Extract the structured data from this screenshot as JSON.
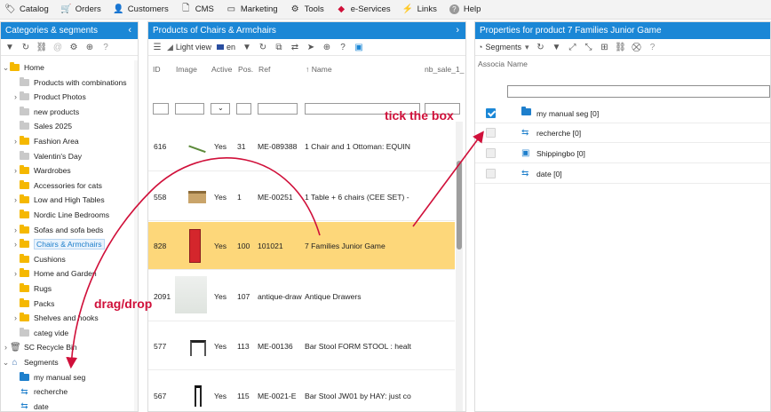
{
  "menu": [
    {
      "label": "Catalog",
      "icon": "catalog-icon",
      "glyph": "🏷"
    },
    {
      "label": "Orders",
      "icon": "cart-icon",
      "glyph": "🛒"
    },
    {
      "label": "Customers",
      "icon": "user-icon",
      "glyph": "👤"
    },
    {
      "label": "CMS",
      "icon": "cms-icon",
      "glyph": "🗋"
    },
    {
      "label": "Marketing",
      "icon": "marketing-icon",
      "glyph": "▭"
    },
    {
      "label": "Tools",
      "icon": "gear-icon",
      "glyph": "⚙"
    },
    {
      "label": "e-Services",
      "icon": "diamond-icon",
      "glyph": "◆"
    },
    {
      "label": "Links",
      "icon": "bolt-icon",
      "glyph": "⚡"
    },
    {
      "label": "Help",
      "icon": "help-icon",
      "glyph": "?"
    }
  ],
  "left_panel": {
    "title": "Categories & segments",
    "tree": [
      {
        "label": "Home",
        "icon": "folder-yellow",
        "caret": "open",
        "indent": 0
      },
      {
        "label": "Products with combinations",
        "icon": "folder-gray",
        "caret": "",
        "indent": 1
      },
      {
        "label": "Product Photos",
        "icon": "folder-gray",
        "caret": "closed",
        "indent": 1
      },
      {
        "label": "new products",
        "icon": "folder-gray",
        "caret": "",
        "indent": 1
      },
      {
        "label": "Sales 2025",
        "icon": "folder-gray",
        "caret": "",
        "indent": 1
      },
      {
        "label": "Fashion Area",
        "icon": "folder-yellow",
        "caret": "closed",
        "indent": 1
      },
      {
        "label": "Valentin's Day",
        "icon": "folder-gray",
        "caret": "",
        "indent": 1
      },
      {
        "label": "Wardrobes",
        "icon": "folder-yellow",
        "caret": "closed",
        "indent": 1
      },
      {
        "label": "Accessories for cats",
        "icon": "folder-yellow",
        "caret": "",
        "indent": 1
      },
      {
        "label": "Low and High Tables",
        "icon": "folder-yellow",
        "caret": "closed",
        "indent": 1
      },
      {
        "label": "Nordic Line Bedrooms",
        "icon": "folder-yellow",
        "caret": "",
        "indent": 1
      },
      {
        "label": "Sofas and sofa beds",
        "icon": "folder-yellow",
        "caret": "closed",
        "indent": 1
      },
      {
        "label": "Chairs & Armchairs",
        "icon": "folder-yellow",
        "caret": "closed",
        "indent": 1,
        "selected": true
      },
      {
        "label": "Cushions",
        "icon": "folder-yellow",
        "caret": "",
        "indent": 1
      },
      {
        "label": "Home and Garden",
        "icon": "folder-yellow",
        "caret": "closed",
        "indent": 1
      },
      {
        "label": "Rugs",
        "icon": "folder-yellow",
        "caret": "",
        "indent": 1
      },
      {
        "label": "Packs",
        "icon": "folder-yellow",
        "caret": "",
        "indent": 1
      },
      {
        "label": "Shelves and hooks",
        "icon": "folder-yellow",
        "caret": "closed",
        "indent": 1
      },
      {
        "label": "categ vide",
        "icon": "folder-gray",
        "caret": "",
        "indent": 1
      },
      {
        "label": "SC Recycle Bin",
        "icon": "trash",
        "caret": "closed",
        "indent": 0
      },
      {
        "label": "Segments",
        "icon": "home",
        "caret": "open",
        "indent": 0
      },
      {
        "label": "my manual seg",
        "icon": "folder-blue",
        "caret": "",
        "indent": 1
      },
      {
        "label": "recherche",
        "icon": "segment",
        "caret": "",
        "indent": 1
      },
      {
        "label": "date",
        "icon": "segment",
        "caret": "",
        "indent": 1
      }
    ]
  },
  "mid_panel": {
    "title": "Products of Chairs & Armchairs",
    "toolbar": {
      "view_label": "Light view",
      "lang_label": "en"
    },
    "columns": [
      "ID",
      "Image",
      "Active",
      "Pos.",
      "Ref",
      "Name",
      "nb_sale_1_"
    ],
    "rows": [
      {
        "id": "616",
        "active": "Yes",
        "pos": "31",
        "ref": "ME-089388",
        "name": "1 Chair and 1 Ottoman: EQUIN",
        "thumb": "chair-lounge"
      },
      {
        "id": "558",
        "active": "Yes",
        "pos": "1",
        "ref": "ME-00251",
        "name": "1 Table + 6 chairs (CEE SET) -",
        "thumb": "table-set"
      },
      {
        "id": "828",
        "active": "Yes",
        "pos": "100",
        "ref": "101021",
        "name": "7 Families Junior Game",
        "thumb": "game-box",
        "selected": true
      },
      {
        "id": "2091",
        "active": "Yes",
        "pos": "107",
        "ref": "antique-draw",
        "name": "Antique Drawers",
        "thumb": "drawers"
      },
      {
        "id": "577",
        "active": "Yes",
        "pos": "113",
        "ref": "ME-00136",
        "name": "Bar Stool FORM STOOL : healt",
        "thumb": "stool"
      },
      {
        "id": "567",
        "active": "Yes",
        "pos": "115",
        "ref": "ME-0021-E",
        "name": "Bar Stool JW01 by HAY: just co",
        "thumb": "stool-black"
      }
    ]
  },
  "right_panel": {
    "title": "Properties for product 7 Families Junior Game",
    "toolbar_label": "Segments",
    "col_assoc": "Associa",
    "col_name": "Name",
    "rows": [
      {
        "label": "my manual seg [0]",
        "checked": true,
        "icon": "folder"
      },
      {
        "label": "recherche [0]",
        "checked": false,
        "icon": "segment"
      },
      {
        "label": "Shippingbo [0]",
        "checked": false,
        "icon": "shippingbo"
      },
      {
        "label": "date [0]",
        "checked": false,
        "icon": "segment"
      }
    ]
  },
  "annotations": {
    "tick": "tick the box",
    "drag": "drag/drop",
    "color": "#d0103a"
  }
}
